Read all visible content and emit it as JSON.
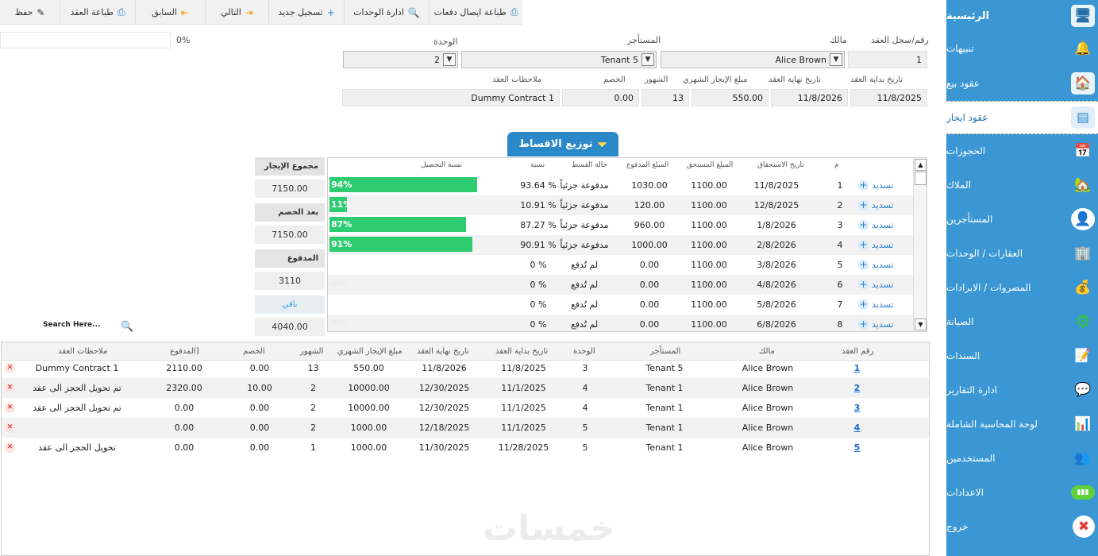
{
  "toolbar": {
    "save": "حفظ",
    "print_contract": "طباعة العقد",
    "previous": "السابق",
    "next": "التالي",
    "new_record": "تسجيل جديد",
    "units_admin": "ادارة الوحدات",
    "print_receipts": "طباعة ايصال دفعات"
  },
  "progress_label": "0%",
  "form": {
    "contract_no_label": "رقم/سجل العقد",
    "contract_no": "1",
    "owner_label": "مالك",
    "owner": "Alice Brown",
    "tenant_label": "المستأجر",
    "tenant": "Tenant 5",
    "unit_label": "الوحدة",
    "unit": "2",
    "start_label": "تاريخ بداية العقد",
    "start": "11/8/2025",
    "end_label": "تاريخ نهاية العقد",
    "end": "11/8/2026",
    "rent_label": "مبلغ الإيجار الشهري",
    "rent": "550.00",
    "months_label": "الشهور",
    "months": "13",
    "discount_label": "الخصم",
    "discount": "0.00",
    "notes_label": "ملاحظات العقد",
    "notes": "Dummy Contract 1"
  },
  "installments": {
    "tab_label": "توزيع الاقساط",
    "headers": {
      "idx": "م",
      "due_date": "تاريخ الاستحقاق",
      "due_amount": "المبلغ المستحق",
      "paid_amount": "المبلغ المدفوع",
      "status": "حالة القسط",
      "ratio": "نسبة",
      "collection": "نسبة التحصيل"
    },
    "pay_label": "تسديد",
    "rows": [
      {
        "idx": "1",
        "due_date": "11/8/2025",
        "due": "1100.00",
        "paid": "1030.00",
        "status": "مدفوعة جزئياً",
        "ratio": "93.64 %",
        "bar_label": "94%",
        "pct": 94
      },
      {
        "idx": "2",
        "due_date": "12/8/2025",
        "due": "1100.00",
        "paid": "120.00",
        "status": "مدفوعة جزئياً",
        "ratio": "10.91 %",
        "bar_label": "11%",
        "pct": 11
      },
      {
        "idx": "3",
        "due_date": "1/8/2026",
        "due": "1100.00",
        "paid": "960.00",
        "status": "مدفوعة جزئياً",
        "ratio": "87.27 %",
        "bar_label": "87%",
        "pct": 87
      },
      {
        "idx": "4",
        "due_date": "2/8/2026",
        "due": "1100.00",
        "paid": "1000.00",
        "status": "مدفوعة جزئياً",
        "ratio": "90.91 %",
        "bar_label": "91%",
        "pct": 91
      },
      {
        "idx": "5",
        "due_date": "3/8/2026",
        "due": "1100.00",
        "paid": "0.00",
        "status": "لم تُدفع",
        "ratio": "0 %",
        "bar_label": "",
        "pct": 0
      },
      {
        "idx": "6",
        "due_date": "4/8/2026",
        "due": "1100.00",
        "paid": "0.00",
        "status": "لم تُدفع",
        "ratio": "0 %",
        "bar_label": "0%",
        "pct": 0
      },
      {
        "idx": "7",
        "due_date": "5/8/2026",
        "due": "1100.00",
        "paid": "0.00",
        "status": "لم تُدفع",
        "ratio": "0 %",
        "bar_label": "",
        "pct": 0
      },
      {
        "idx": "8",
        "due_date": "6/8/2026",
        "due": "1100.00",
        "paid": "0.00",
        "status": "لم تُدفع",
        "ratio": "0 %",
        "bar_label": "0%",
        "pct": 0
      }
    ]
  },
  "summary": {
    "total_rent_label": "مجموع الإيجار",
    "total_rent": "7150.00",
    "after_discount_label": "بعد الخصم",
    "after_discount": "7150.00",
    "paid_label": "المدفوع",
    "paid": "3110",
    "remaining_label": "باقي",
    "remaining": "4040.00"
  },
  "search": {
    "placeholder": "Search Here..."
  },
  "contracts": {
    "headers": {
      "no": "رقم العقد",
      "owner": "مالك",
      "tenant": "المستأجر",
      "unit": "الوحدة",
      "start": "تاريخ بداية العقد",
      "end": "تاريخ نهاية العقد",
      "rent": "مبلغ الإيجار الشهري",
      "months": "الشهور",
      "discount": "الخصم",
      "paid": "المدفوع]",
      "notes": "ملاحظات العقد"
    },
    "rows": [
      {
        "no": "1",
        "owner": "Alice Brown",
        "tenant": "Tenant 5",
        "unit": "3",
        "start": "11/8/2025",
        "end": "11/8/2026",
        "rent": "550.00",
        "months": "13",
        "discount": "0.00",
        "paid": "2110.00",
        "notes": "Dummy Contract 1"
      },
      {
        "no": "2",
        "owner": "Alice Brown",
        "tenant": "Tenant 1",
        "unit": "4",
        "start": "11/1/2025",
        "end": "12/30/2025",
        "rent": "10000.00",
        "months": "2",
        "discount": "10.00",
        "paid": "2320.00",
        "notes": "تم تحويل الحجز الى عقد"
      },
      {
        "no": "3",
        "owner": "Alice Brown",
        "tenant": "Tenant 1",
        "unit": "4",
        "start": "11/1/2025",
        "end": "12/30/2025",
        "rent": "10000.00",
        "months": "2",
        "discount": "0.00",
        "paid": "0.00",
        "notes": "تم تحويل الحجز الى عقد"
      },
      {
        "no": "4",
        "owner": "Alice Brown",
        "tenant": "Tenant 1",
        "unit": "5",
        "start": "11/1/2025",
        "end": "12/18/2025",
        "rent": "1000.00",
        "months": "2",
        "discount": "0.00",
        "paid": "0.00",
        "notes": ""
      },
      {
        "no": "5",
        "owner": "Alice Brown",
        "tenant": "Tenant 1",
        "unit": "5",
        "start": "11/28/2025",
        "end": "11/30/2025",
        "rent": "1000.00",
        "months": "1",
        "discount": "0.00",
        "paid": "0.00",
        "notes": "تحويل الحجز الى عقد"
      }
    ]
  },
  "sidebar": {
    "items": [
      {
        "label": "الرئيسية",
        "icon": "monitor-icon",
        "glyph": "🖥"
      },
      {
        "label": "تنبيهات",
        "icon": "bell-icon",
        "glyph": "🔔"
      },
      {
        "label": "عقود بيع",
        "icon": "sale-contract-icon",
        "glyph": "🏠"
      },
      {
        "label": "عقود ايجار",
        "icon": "rent-contract-icon",
        "glyph": "▤"
      },
      {
        "label": "الحجوزات",
        "icon": "calendar-icon",
        "glyph": "📅"
      },
      {
        "label": "الملاك",
        "icon": "owner-icon",
        "glyph": "🏡"
      },
      {
        "label": "المستأجرين",
        "icon": "tenant-icon",
        "glyph": "👤"
      },
      {
        "label": "العقارات / الوحدات",
        "icon": "buildings-icon",
        "glyph": "🏢"
      },
      {
        "label": "المصروات / الايرادات",
        "icon": "coins-icon",
        "glyph": "💰"
      },
      {
        "label": "الصيانة",
        "icon": "gear-icon",
        "glyph": "⚙"
      },
      {
        "label": "السندات",
        "icon": "document-icon",
        "glyph": "📝"
      },
      {
        "label": "ادارة التقارير",
        "icon": "reports-icon",
        "glyph": "💬"
      },
      {
        "label": "لوحة المحاسبة الشاملة",
        "icon": "dashboard-icon",
        "glyph": "📊"
      },
      {
        "label": "المستخدمين",
        "icon": "users-icon",
        "glyph": "👥"
      },
      {
        "label": "الاعدادات",
        "icon": "settings-icon",
        "glyph": "▮▮▮"
      },
      {
        "label": "خروج",
        "icon": "exit-icon",
        "glyph": "✖"
      }
    ]
  },
  "watermark": "خمسات",
  "colors": {
    "sidebar": "#3a97d3",
    "accent": "#2b88c9",
    "progress": "#2ecc71",
    "link": "#2a7fd0"
  }
}
